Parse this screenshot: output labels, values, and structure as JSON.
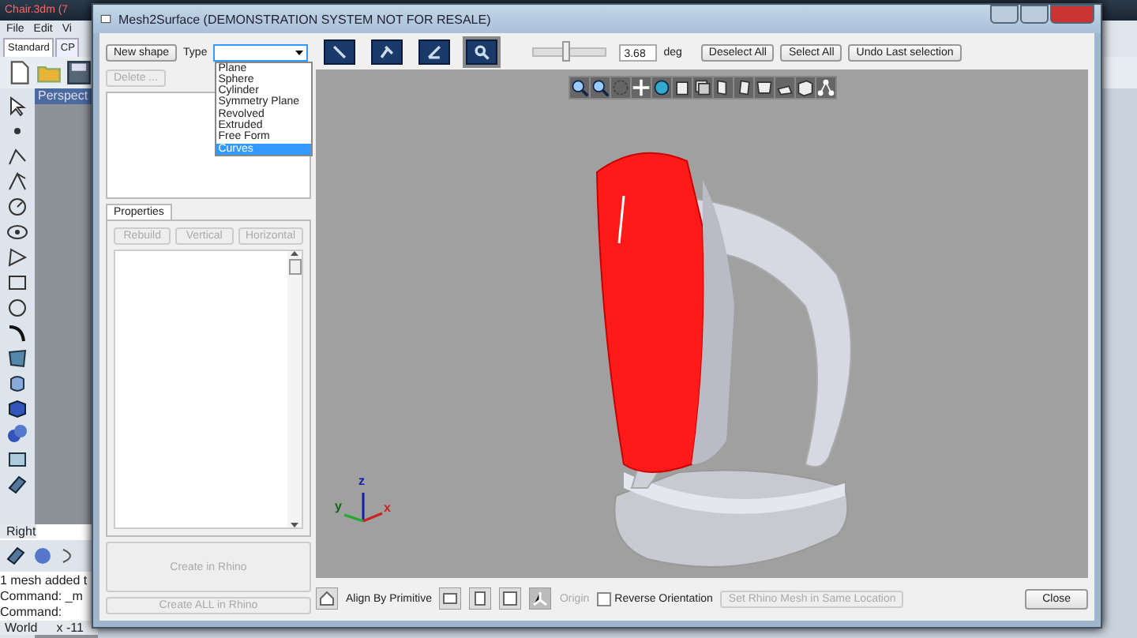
{
  "background_window": {
    "title": "Chair.3dm (7",
    "menu": [
      "File",
      "Edit",
      "Vi"
    ],
    "tabs": [
      {
        "label": "Standard",
        "selected": true
      },
      {
        "label": "CP",
        "selected": false
      }
    ],
    "viewport_labels": [
      "Perspect",
      "Right"
    ],
    "command_lines": [
      "1 mesh added t",
      "Command: _m",
      "Command:"
    ],
    "status_bar": [
      "World",
      "x -11"
    ]
  },
  "dialog": {
    "title": "Mesh2Surface (DEMONSTRATION SYSTEM NOT FOR RESALE)",
    "new_shape_button": "New shape",
    "type_label": "Type",
    "type_options": [
      {
        "label": "Plane",
        "selected": false
      },
      {
        "label": "Sphere",
        "selected": false
      },
      {
        "label": "Cylinder",
        "selected": false
      },
      {
        "label": "Symmetry Plane",
        "selected": false
      },
      {
        "label": "Revolved",
        "selected": false
      },
      {
        "label": "Extruded",
        "selected": false
      },
      {
        "label": "Free Form",
        "selected": false
      },
      {
        "label": "Curves",
        "selected": true
      }
    ],
    "mode_buttons": [
      {
        "selected": false
      },
      {
        "selected": false
      },
      {
        "selected": false
      },
      {
        "selected": true
      }
    ],
    "angle_slider": {
      "level": 0.45
    },
    "angle_value": "3.68",
    "angle_unit": "deg",
    "selection_buttons": [
      "Deselect All",
      "Select All",
      "Undo Last selection"
    ],
    "delete_button": {
      "label": "Delete ...",
      "disabled": true
    },
    "properties_tab": {
      "label": "Properties",
      "selected": true
    },
    "property_buttons": [
      {
        "label": "Rebuild",
        "disabled": true
      },
      {
        "label": "Vertical",
        "disabled": true
      },
      {
        "label": "Horizontal",
        "disabled": true
      }
    ],
    "create_button": {
      "label": "Create in Rhino",
      "disabled": true
    },
    "create_all_button": {
      "label": "Create ALL in Rhino",
      "disabled": true
    },
    "axis_labels": [
      "z",
      "y",
      "x"
    ],
    "align_label": "Align By Primitive",
    "origin_label": {
      "label": "Origin",
      "disabled": true
    },
    "reverse_orientation": {
      "label": "Reverse Orientation",
      "checked": false
    },
    "same_location_button": {
      "label": "Set Rhino Mesh in Same Location",
      "disabled": true
    },
    "close_button": "Close"
  }
}
